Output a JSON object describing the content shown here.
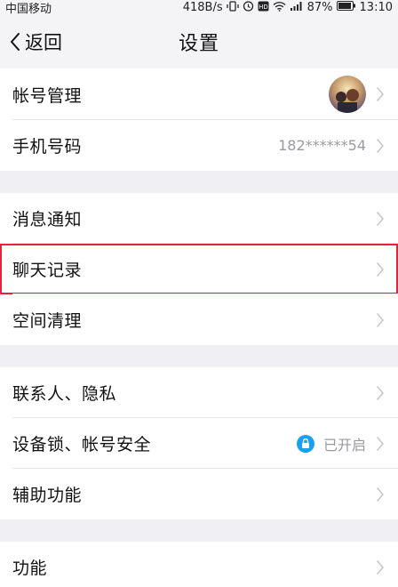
{
  "status_bar": {
    "carrier": "中国移动",
    "network_speed": "418B/s",
    "battery_percent": "87%",
    "time": "13:10"
  },
  "nav": {
    "back_label": "返回",
    "title": "设置"
  },
  "sections": [
    {
      "items": [
        {
          "label": "帐号管理",
          "value": ""
        },
        {
          "label": "手机号码",
          "value": "182******54"
        }
      ]
    },
    {
      "items": [
        {
          "label": "消息通知",
          "value": ""
        },
        {
          "label": "聊天记录",
          "value": ""
        },
        {
          "label": "空间清理",
          "value": ""
        }
      ]
    },
    {
      "items": [
        {
          "label": "联系人、隐私",
          "value": ""
        },
        {
          "label": "设备锁、帐号安全",
          "value": "已开启"
        },
        {
          "label": "辅助功能",
          "value": ""
        }
      ]
    },
    {
      "items": [
        {
          "label": "功能",
          "value": ""
        }
      ]
    }
  ],
  "colors": {
    "highlight_border": "#e5243b",
    "lock_icon": "#1aa0f0"
  },
  "icons": {
    "back": "chevron-left-icon",
    "row_arrow": "chevron-right-icon",
    "lock": "lock-icon",
    "avatar": "avatar-image"
  }
}
